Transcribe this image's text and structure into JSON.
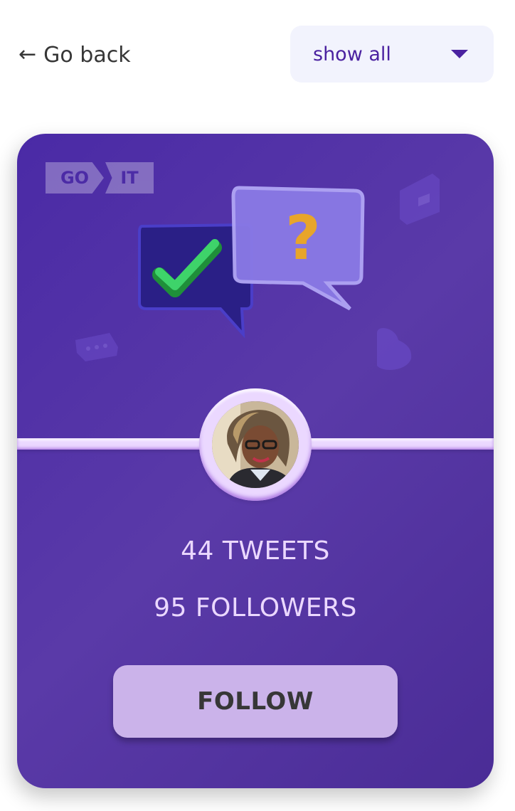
{
  "header": {
    "back_arrow": "←",
    "back_label": "Go back",
    "filter": {
      "selected": "show all"
    }
  },
  "card": {
    "logo": {
      "part1": "GO",
      "part2": "IT"
    },
    "hero_illustration": {
      "icons": [
        "check-message-icon",
        "question-message-icon"
      ],
      "question_mark": "?"
    },
    "tweets": "44 TWEETS",
    "followers": "95 FOLLOWERS",
    "follow_label": "FOLLOW"
  },
  "colors": {
    "accent": "#4b22a0",
    "card_background": "#5736a3",
    "button": "#cbb3ea",
    "text_light": "#ebd8ff"
  }
}
